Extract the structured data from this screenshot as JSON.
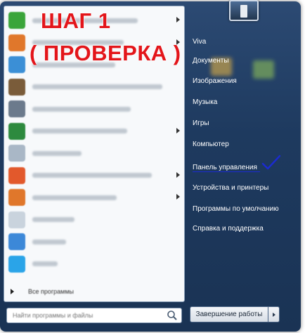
{
  "caption": {
    "line1": "ШАГ 1",
    "line2": "( ПРОВЕРКА )"
  },
  "left_pane": {
    "programs": [
      {
        "icon": "green-app-icon",
        "color": "#3aa53a",
        "has_arrow": true
      },
      {
        "icon": "firefox-icon",
        "color": "#e0772b",
        "has_arrow": true
      },
      {
        "icon": "bird-app-icon",
        "color": "#3b8fd6",
        "has_arrow": false
      },
      {
        "icon": "shield-app-icon",
        "color": "#7a5c3a",
        "has_arrow": false
      },
      {
        "icon": "globe-app-icon",
        "color": "#6b7a8c",
        "has_arrow": false
      },
      {
        "icon": "excel-icon",
        "color": "#2d8a3e",
        "has_arrow": true
      },
      {
        "icon": "calculator-icon",
        "color": "#a9b7c6",
        "has_arrow": false
      },
      {
        "icon": "powerpoint-icon",
        "color": "#e2592c",
        "has_arrow": true
      },
      {
        "icon": "firefox-icon",
        "color": "#e0772b",
        "has_arrow": true
      },
      {
        "icon": "document-icon",
        "color": "#c9d3dd",
        "has_arrow": false
      },
      {
        "icon": "blue-app-icon",
        "color": "#3c88d8",
        "has_arrow": false
      },
      {
        "icon": "skype-icon",
        "color": "#2aa4e8",
        "has_arrow": false
      }
    ],
    "all_programs_label": "Все программы",
    "search_placeholder": "Найти программы и файлы"
  },
  "right_pane": {
    "items": [
      {
        "label": "Viva"
      },
      {
        "label": "Документы"
      },
      {
        "label": "Изображения"
      },
      {
        "label": "Музыка"
      },
      {
        "label": "Игры"
      },
      {
        "label": "Компьютер"
      },
      {
        "label": "Панель управления"
      },
      {
        "label": "Устройства и принтеры"
      },
      {
        "label": "Программы по умолчанию"
      },
      {
        "label": "Справка и поддержка"
      }
    ],
    "shutdown_label": "Завершение работы"
  },
  "colors": {
    "caption_red": "#e3151a",
    "checkmark_blue": "#1b2bd1",
    "menu_dark_blue": "#1e3a5f"
  }
}
